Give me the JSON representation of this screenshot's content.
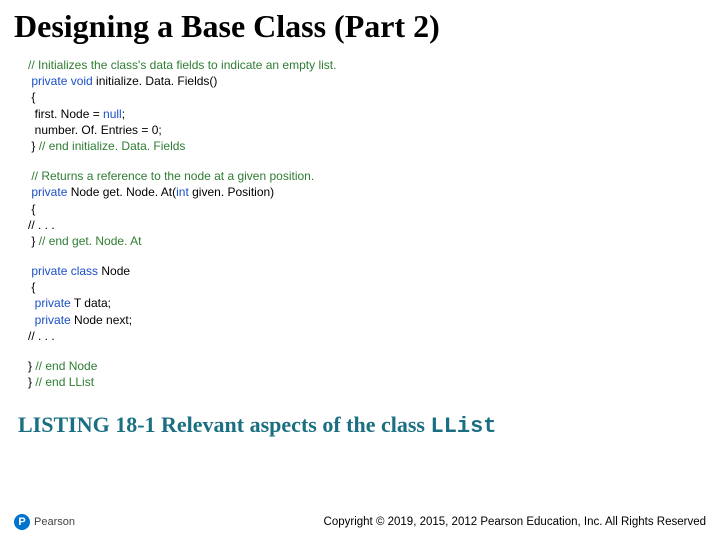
{
  "title": "Designing a Base Class (Part 2)",
  "code": {
    "block1": {
      "c1": "// Initializes the class's data fields to indicate an empty list.",
      "l1a": "private void",
      "l1b": " initialize. Data. Fields()",
      "l2": "{",
      "l3a": "   first. Node = ",
      "l3b": "null",
      "l3c": ";",
      "l4": "   number. Of. Entries = 0;",
      "l5a": "} ",
      "l5b": "// end initialize. Data. Fields"
    },
    "block2": {
      "c1": "// Returns a reference to the node at a given position.",
      "l1a": "private",
      "l1b": " Node get. Node. At(",
      "l1c": "int",
      "l1d": " given. Position)",
      "l2": "{",
      "l3a": "//",
      "l3b": "   . . .",
      "l4a": "} ",
      "l4b": "// end get. Node. At"
    },
    "block3": {
      "l1a": "private class",
      "l1b": " Node",
      "l2": "{",
      "l3a": "   private",
      "l3b": " T data;",
      "l4a": "   private",
      "l4b": " Node next;",
      "l5a": "//",
      "l5b": "   . . ."
    },
    "block4": {
      "l1a": "   } ",
      "l1b": "// end Node",
      "l2a": "} ",
      "l2b": "// end LList"
    }
  },
  "listing": {
    "prefix": "LISTING 18-1 Relevant aspects of the class ",
    "classname": "LList"
  },
  "footer": {
    "brand_letter": "P",
    "brand": "Pearson",
    "copyright": "Copyright © 2019, 2015, 2012 Pearson Education, Inc. All Rights Reserved"
  }
}
